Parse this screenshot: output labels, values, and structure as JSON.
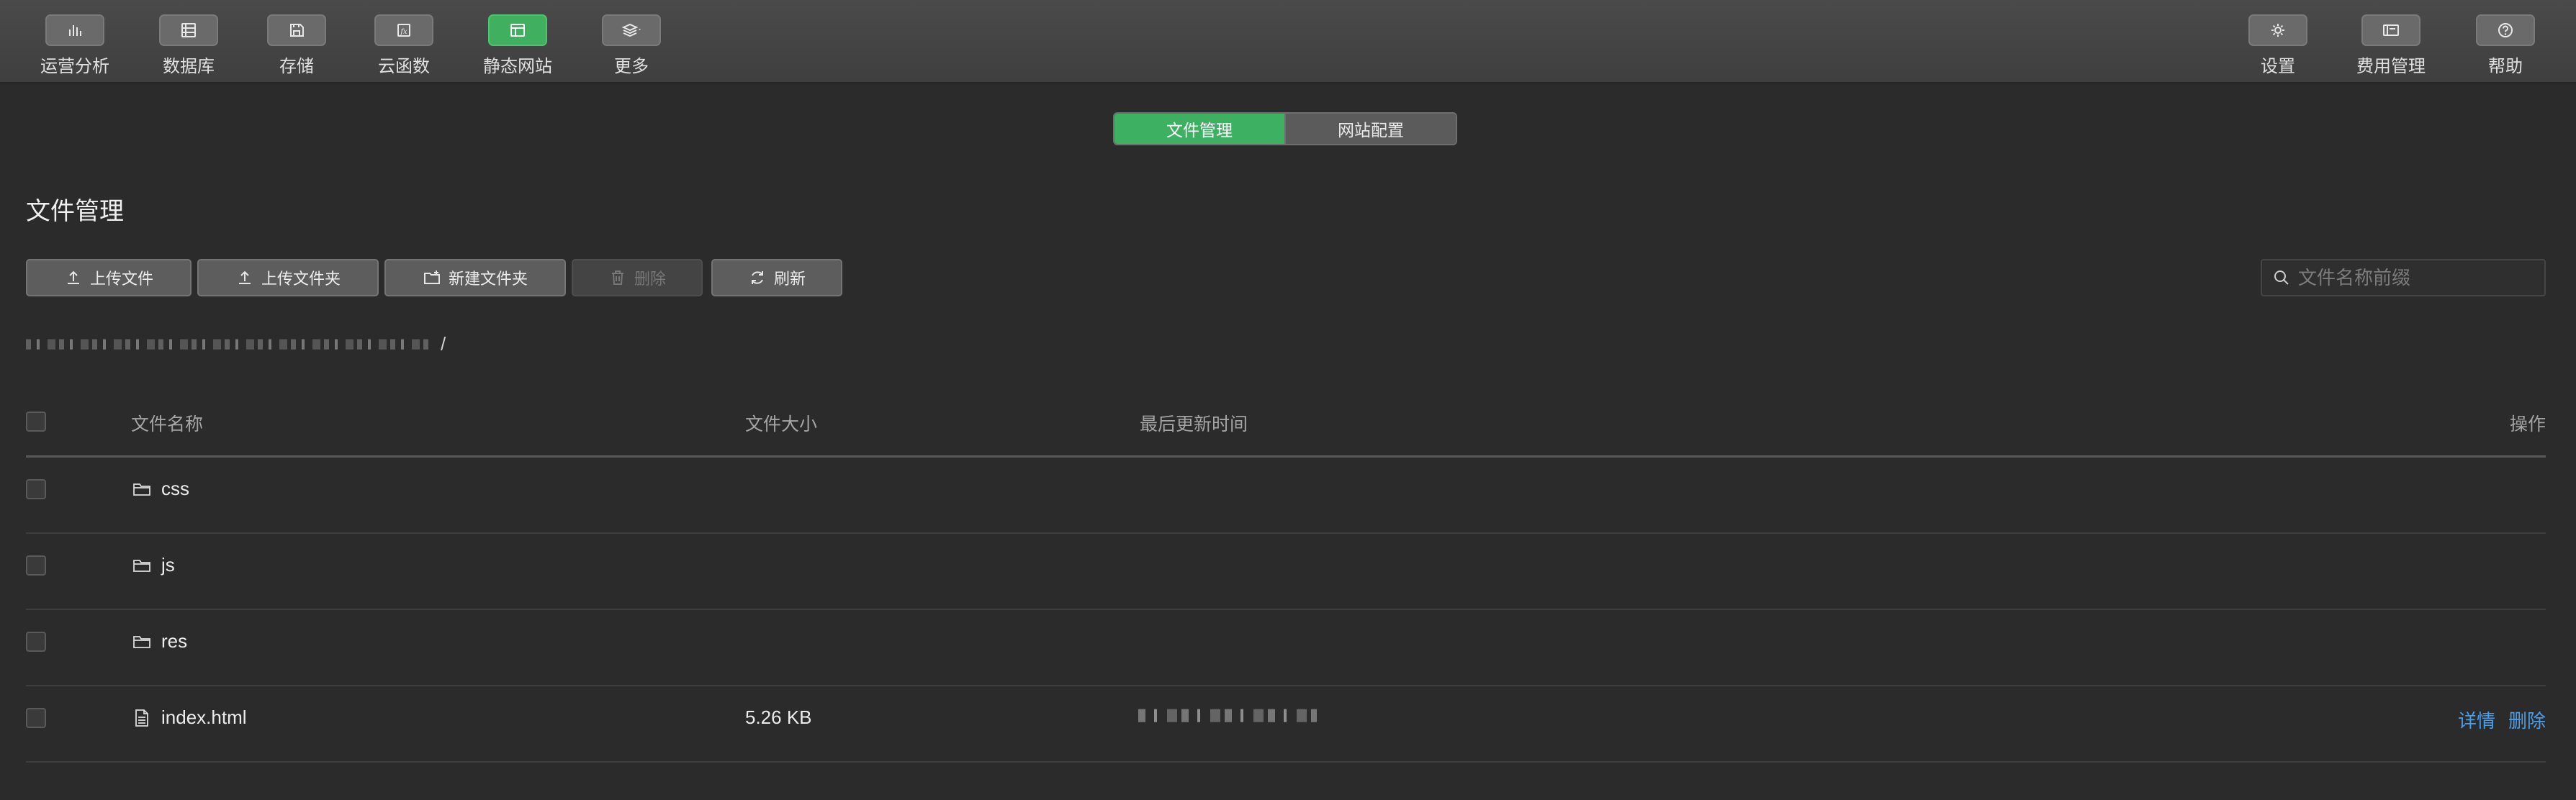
{
  "toolbar": {
    "left_items": [
      {
        "label": "运营分析",
        "icon": "bar-chart-icon"
      },
      {
        "label": "数据库",
        "icon": "database-icon"
      },
      {
        "label": "存储",
        "icon": "storage-icon"
      },
      {
        "label": "云函数",
        "icon": "cloud-function-icon"
      },
      {
        "label": "静态网站",
        "icon": "static-website-icon",
        "active": true
      },
      {
        "label": "更多",
        "icon": "layers-icon"
      }
    ],
    "right_items": [
      {
        "label": "设置",
        "icon": "gear-icon"
      },
      {
        "label": "费用管理",
        "icon": "billing-icon"
      },
      {
        "label": "帮助",
        "icon": "help-icon"
      }
    ]
  },
  "tabs": [
    {
      "label": "文件管理",
      "active": true
    },
    {
      "label": "网站配置",
      "active": false
    }
  ],
  "page_title": "文件管理",
  "actions": {
    "upload_file": "上传文件",
    "upload_folder": "上传文件夹",
    "new_folder": "新建文件夹",
    "delete": "删除",
    "refresh": "刷新"
  },
  "search": {
    "placeholder": "文件名称前缀"
  },
  "breadcrumb": {
    "separator": "/"
  },
  "table": {
    "columns": [
      "文件名称",
      "文件大小",
      "最后更新时间",
      "操作"
    ],
    "rows": [
      {
        "name": "css",
        "type": "folder",
        "size": "",
        "updated": ""
      },
      {
        "name": "js",
        "type": "folder",
        "size": "",
        "updated": ""
      },
      {
        "name": "res",
        "type": "folder",
        "size": "",
        "updated": ""
      },
      {
        "name": "index.html",
        "type": "file",
        "size": "5.26 KB",
        "updated": "",
        "ops": [
          "详情",
          "删除"
        ]
      }
    ]
  },
  "colors": {
    "accent_green": "#3db061",
    "link_blue": "#4a9ee8",
    "background": "#2b2b2b"
  }
}
